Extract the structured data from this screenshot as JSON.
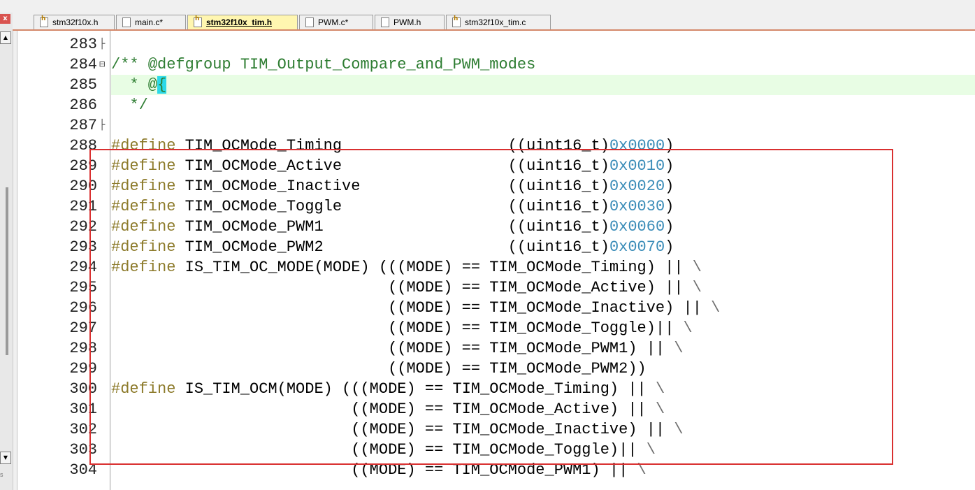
{
  "tabs": [
    {
      "label": "stm32f10x.h",
      "icon": "header-file-icon",
      "active": false
    },
    {
      "label": "main.c*",
      "icon": "source-file-icon",
      "active": false
    },
    {
      "label": "stm32f10x_tim.h",
      "icon": "header-file-icon",
      "active": true
    },
    {
      "label": "PWM.c*",
      "icon": "source-file-icon",
      "active": false
    },
    {
      "label": "PWM.h",
      "icon": "source-file-icon",
      "active": false
    },
    {
      "label": "stm32f10x_tim.c",
      "icon": "header-file-icon",
      "active": false
    }
  ],
  "left_pane": {
    "close_label": "x",
    "bottom_label": "s"
  },
  "lines": [
    {
      "n": "283",
      "text": ""
    },
    {
      "n": "284",
      "text": "/** @defgroup TIM_Output_Compare_and_PWM_modes"
    },
    {
      "n": "285",
      "text": "  * @{"
    },
    {
      "n": "286",
      "text": "  */"
    },
    {
      "n": "287",
      "text": ""
    },
    {
      "n": "288",
      "text": "#define TIM_OCMode_Timing                  ((uint16_t)0x0000)"
    },
    {
      "n": "289",
      "text": "#define TIM_OCMode_Active                  ((uint16_t)0x0010)"
    },
    {
      "n": "290",
      "text": "#define TIM_OCMode_Inactive                ((uint16_t)0x0020)"
    },
    {
      "n": "291",
      "text": "#define TIM_OCMode_Toggle                  ((uint16_t)0x0030)"
    },
    {
      "n": "292",
      "text": "#define TIM_OCMode_PWM1                    ((uint16_t)0x0060)"
    },
    {
      "n": "293",
      "text": "#define TIM_OCMode_PWM2                    ((uint16_t)0x0070)"
    },
    {
      "n": "294",
      "text": "#define IS_TIM_OC_MODE(MODE) (((MODE) == TIM_OCMode_Timing) || \\"
    },
    {
      "n": "295",
      "text": "                              ((MODE) == TIM_OCMode_Active) || \\"
    },
    {
      "n": "296",
      "text": "                              ((MODE) == TIM_OCMode_Inactive) || \\"
    },
    {
      "n": "297",
      "text": "                              ((MODE) == TIM_OCMode_Toggle)|| \\"
    },
    {
      "n": "298",
      "text": "                              ((MODE) == TIM_OCMode_PWM1) || \\"
    },
    {
      "n": "299",
      "text": "                              ((MODE) == TIM_OCMode_PWM2))"
    },
    {
      "n": "300",
      "text": "#define IS_TIM_OCM(MODE) (((MODE) == TIM_OCMode_Timing) || \\"
    },
    {
      "n": "301",
      "text": "                          ((MODE) == TIM_OCMode_Active) || \\"
    },
    {
      "n": "302",
      "text": "                          ((MODE) == TIM_OCMode_Inactive) || \\"
    },
    {
      "n": "303",
      "text": "                          ((MODE) == TIM_OCMode_Toggle)|| \\"
    },
    {
      "n": "304",
      "text": "                          ((MODE) == TIM_OCMode_PWM1) || \\"
    }
  ],
  "colors": {
    "keyword": "#8c7a2a",
    "comment": "#2e7d32",
    "number": "#3a8cb8",
    "highlight_bg": "#e8fde4",
    "annotation_box": "#d93030",
    "cursor": "#2bd9e8"
  }
}
